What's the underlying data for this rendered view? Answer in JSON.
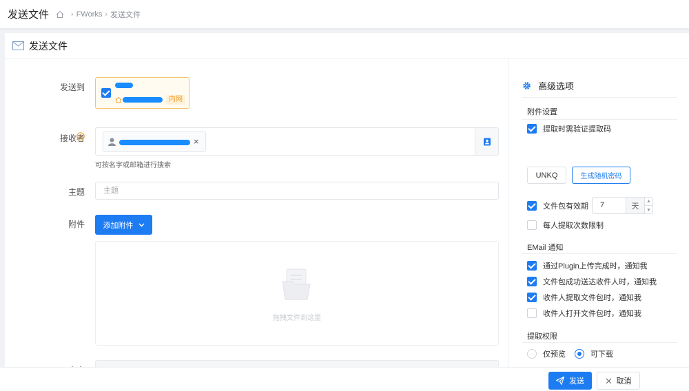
{
  "header": {
    "title": "发送文件",
    "breadcrumb": [
      "FWorks",
      "发送文件"
    ]
  },
  "panel": {
    "title": "发送文件"
  },
  "form": {
    "sendto_label": "发送到",
    "sendto_tag": "内网",
    "receiver_label": "接收者",
    "receiver_hint": "可按名字或邮箱进行搜索",
    "subject_label": "主题",
    "subject_placeholder": "主题",
    "attachment_label": "附件",
    "add_attachment": "添加附件",
    "dropzone_text": "拖拽文件到这里",
    "content_label": "内容"
  },
  "advanced": {
    "title": "高级选项",
    "attachment_section": "附件设置",
    "require_code": {
      "label": "提取时需验证提取码",
      "checked": true
    },
    "code_value": "UNKQ",
    "gen_random": "生成随机密码",
    "validity": {
      "label": "文件包有效期",
      "checked": true,
      "value": "7",
      "unit": "天"
    },
    "limit_per_person": {
      "label": "每人提取次数限制",
      "checked": false
    },
    "email_section": "EMail 通知",
    "notifications": [
      {
        "label": "通过Plugin上传完成时，通知我",
        "checked": true
      },
      {
        "label": "文件包成功送达收件人时，通知我",
        "checked": true
      },
      {
        "label": "收件人提取文件包时，通知我",
        "checked": true
      },
      {
        "label": "收件人打开文件包时，通知我",
        "checked": false
      }
    ],
    "permission_section": "提取权限",
    "permissions": [
      {
        "label": "仅预览",
        "selected": false
      },
      {
        "label": "可下载",
        "selected": true
      }
    ]
  },
  "footer": {
    "send": "发送",
    "cancel": "取消"
  },
  "colors": {
    "accent": "#1e7cf2",
    "warning_border": "#f5c46a"
  }
}
